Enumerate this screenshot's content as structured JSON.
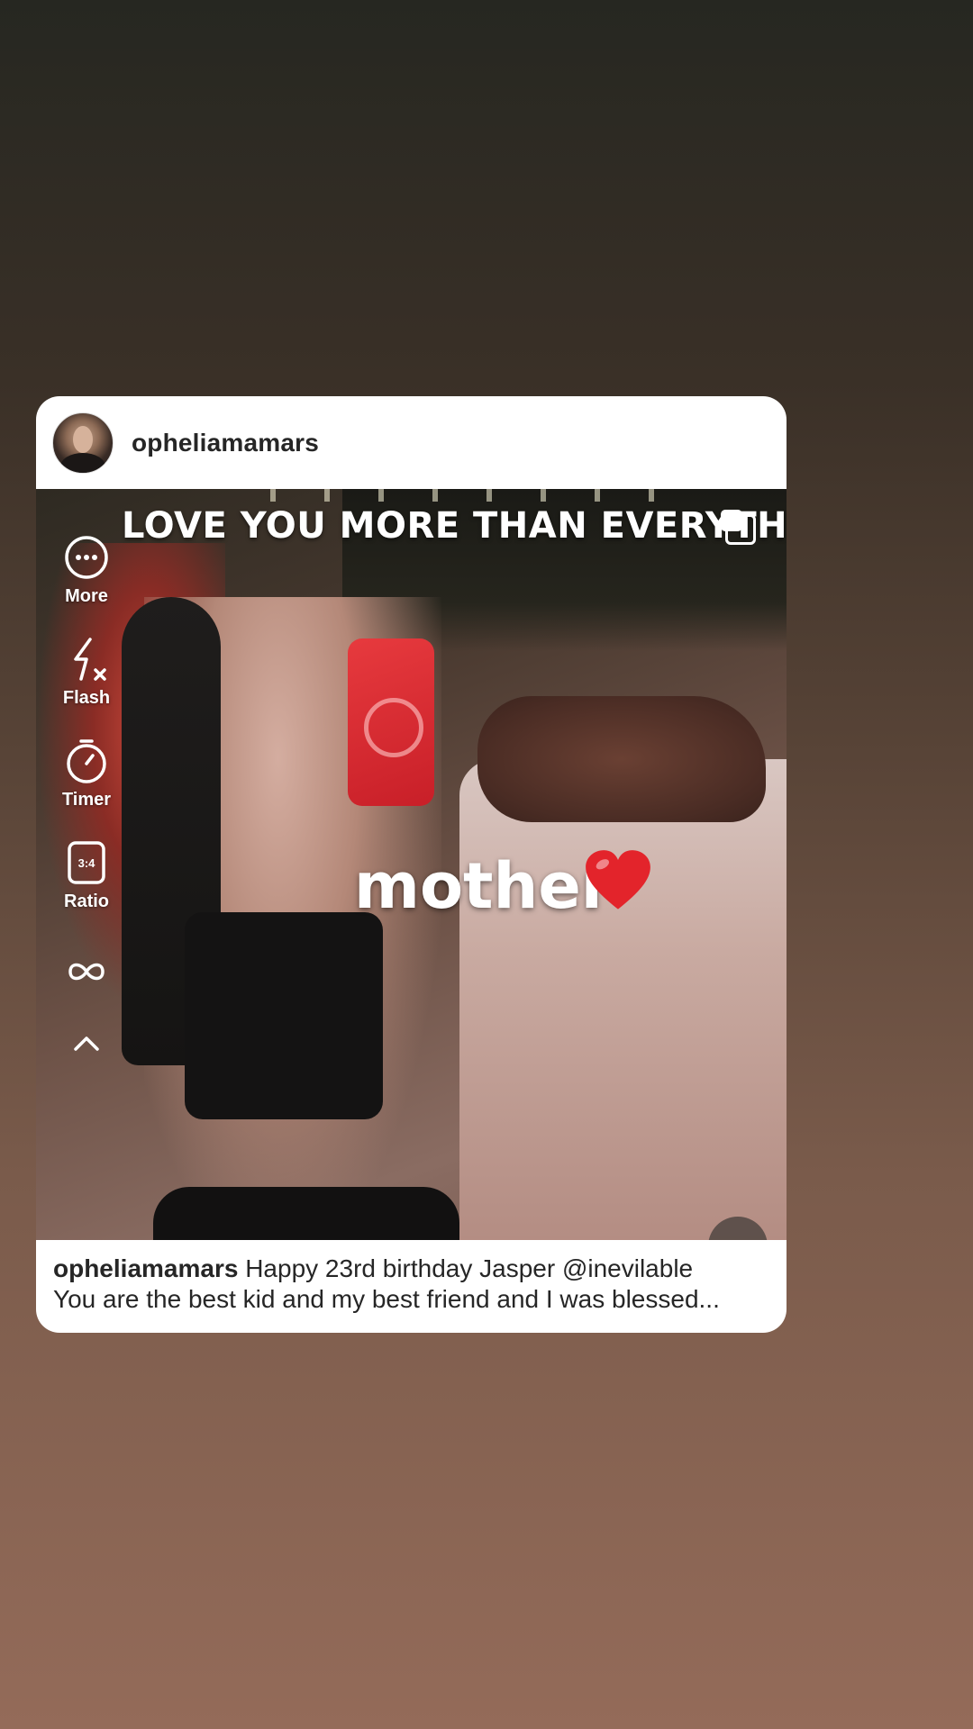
{
  "post": {
    "username": "opheliamamars",
    "overlay_text_top": "LOVE YOU MORE THAN EVERYTHING",
    "overlay_text_center": "mother",
    "caption_username": "opheliamamars",
    "caption_line1": "Happy 23rd birthday Jasper @inevilable",
    "caption_line2": "You are the best kid and my best friend and I was blessed..."
  },
  "tools": [
    {
      "label": "More",
      "icon": "more-icon"
    },
    {
      "label": "Flash",
      "icon": "flash-off-icon"
    },
    {
      "label": "Timer",
      "icon": "timer-icon"
    },
    {
      "label": "Ratio",
      "icon": "ratio-icon",
      "badge": "3:4"
    },
    {
      "label": "",
      "icon": "boomerang-icon"
    },
    {
      "label": "",
      "icon": "chevron-up-icon"
    }
  ],
  "colors": {
    "card_background": "#ffffff",
    "username_text": "#262626",
    "heart": "#e3242b"
  }
}
